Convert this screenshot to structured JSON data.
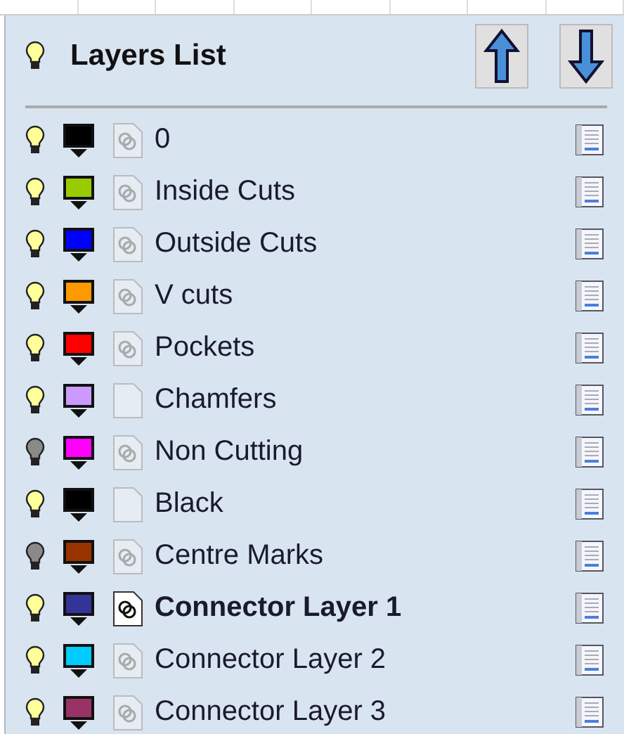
{
  "panel": {
    "title": "Layers List"
  },
  "layers": [
    {
      "name": "0",
      "visible": true,
      "color": "#000000",
      "kind": "linked",
      "selected": false
    },
    {
      "name": "Inside Cuts",
      "visible": true,
      "color": "#99cc00",
      "kind": "linked",
      "selected": false
    },
    {
      "name": "Outside Cuts",
      "visible": true,
      "color": "#0000ff",
      "kind": "linked",
      "selected": false
    },
    {
      "name": "V cuts",
      "visible": true,
      "color": "#ff9900",
      "kind": "linked",
      "selected": false
    },
    {
      "name": "Pockets",
      "visible": true,
      "color": "#ff0000",
      "kind": "linked",
      "selected": false
    },
    {
      "name": "Chamfers",
      "visible": true,
      "color": "#cc99ff",
      "kind": "blank",
      "selected": false
    },
    {
      "name": "Non Cutting",
      "visible": false,
      "color": "#ff00ff",
      "kind": "linked",
      "selected": false
    },
    {
      "name": "Black",
      "visible": true,
      "color": "#000000",
      "kind": "blank",
      "selected": false
    },
    {
      "name": "Centre Marks",
      "visible": false,
      "color": "#993300",
      "kind": "linked",
      "selected": false
    },
    {
      "name": "Connector Layer 1",
      "visible": true,
      "color": "#333399",
      "kind": "linked",
      "selected": true
    },
    {
      "name": "Connector Layer 2",
      "visible": true,
      "color": "#00ccff",
      "kind": "linked",
      "selected": false
    },
    {
      "name": "Connector Layer 3",
      "visible": true,
      "color": "#993366",
      "kind": "linked",
      "selected": false
    }
  ]
}
